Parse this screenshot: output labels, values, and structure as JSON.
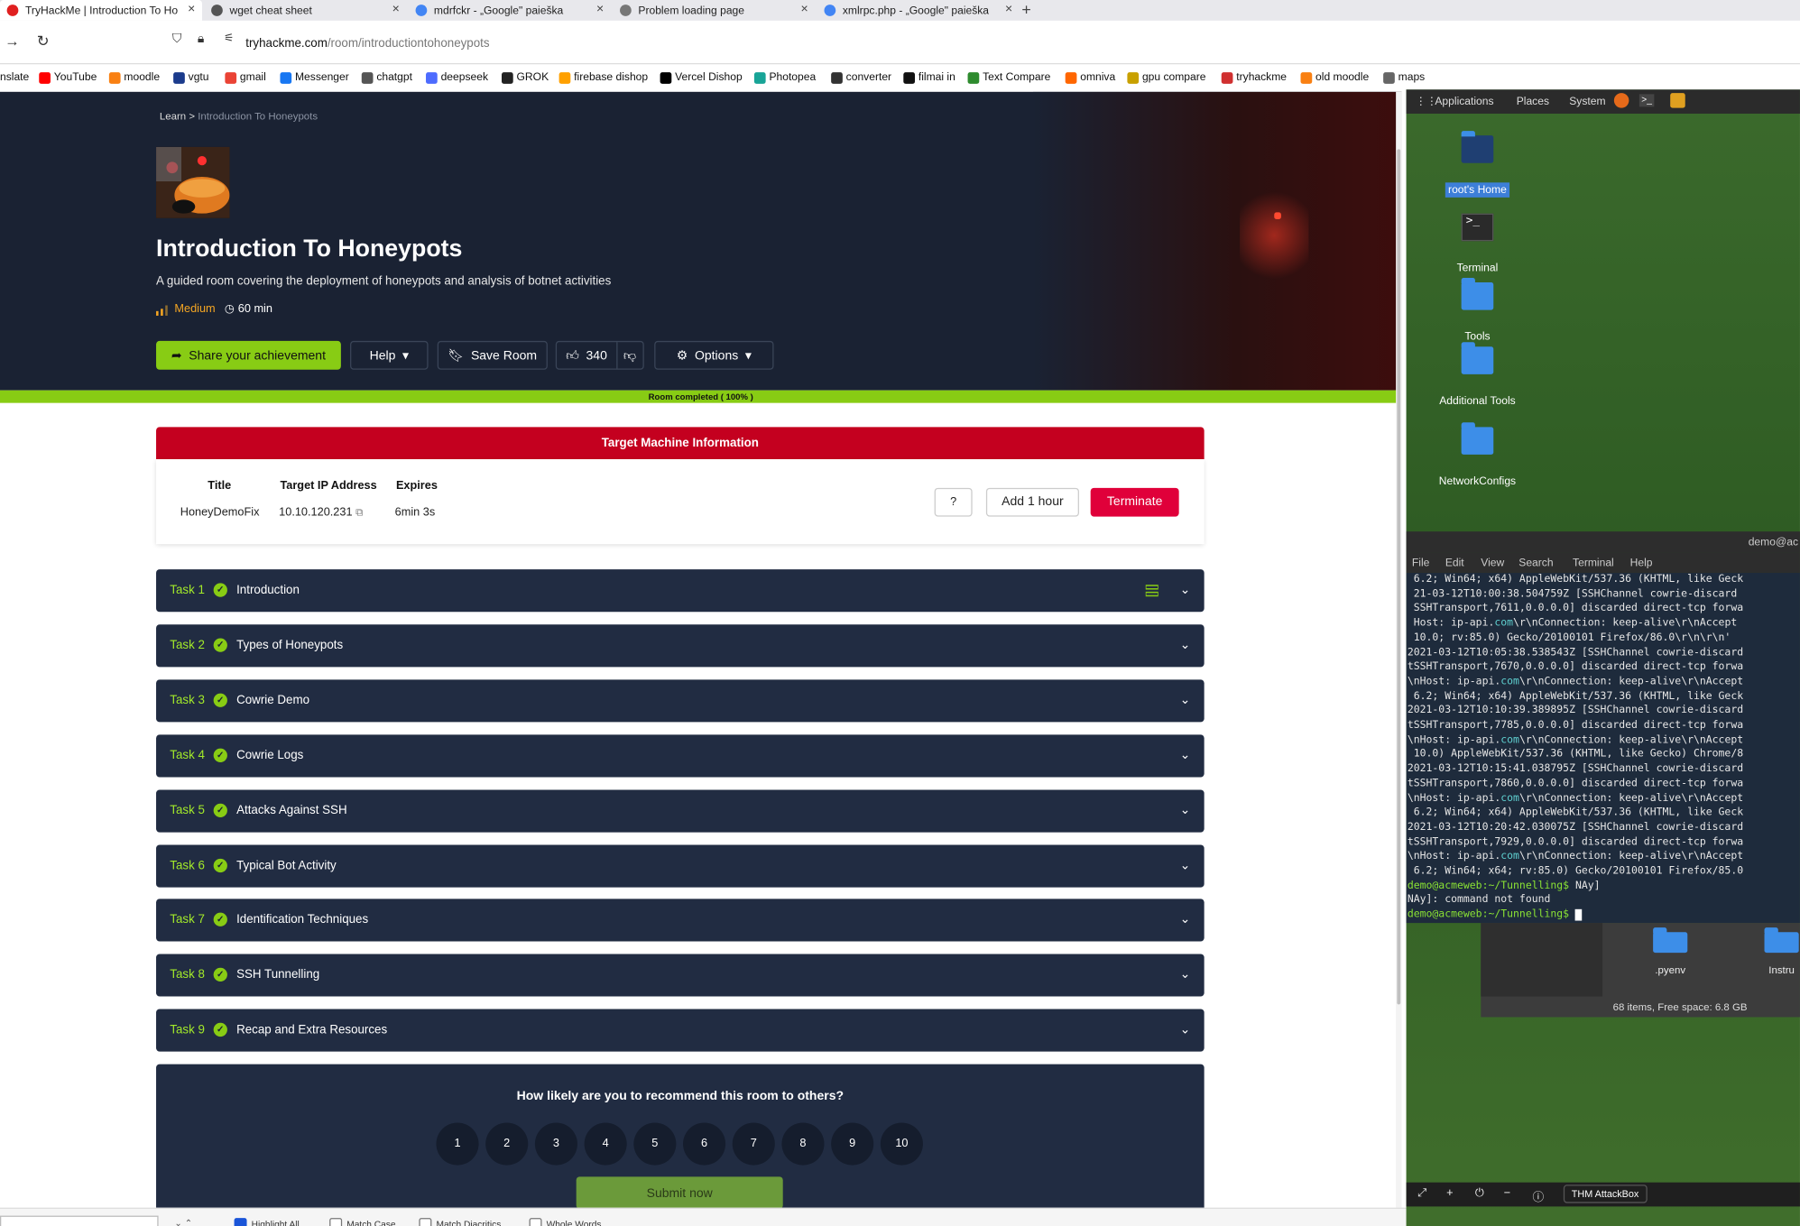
{
  "browser": {
    "tabs": [
      {
        "label": "TryHackMe | Introduction To Ho",
        "color": "#e02020",
        "active": true
      },
      {
        "label": "wget cheat sheet",
        "color": "#555555",
        "active": false
      },
      {
        "label": "mdrfckr - „Google\" paieška",
        "color": "#4285f4",
        "active": false
      },
      {
        "label": "Problem loading page",
        "color": "#777777",
        "active": false
      },
      {
        "label": "xmlrpc.php - „Google\" paieška",
        "color": "#4285f4",
        "active": false
      }
    ],
    "url_host": "tryhackme.com",
    "url_path": "/room/introductiontohoneypots",
    "bookmarks": [
      {
        "label": "nslate",
        "color": "transparent"
      },
      {
        "label": "YouTube",
        "color": "#ff0000"
      },
      {
        "label": "moodle",
        "color": "#f98012"
      },
      {
        "label": "vgtu",
        "color": "#1b3b8c"
      },
      {
        "label": "gmail",
        "color": "#ea4335"
      },
      {
        "label": "Messenger",
        "color": "#1877f2"
      },
      {
        "label": "chatgpt",
        "color": "#555555"
      },
      {
        "label": "deepseek",
        "color": "#4d6bfe"
      },
      {
        "label": "GROK",
        "color": "#222222"
      },
      {
        "label": "firebase dishop",
        "color": "#ffa000"
      },
      {
        "label": "Vercel Dishop",
        "color": "#000000"
      },
      {
        "label": "Photopea",
        "color": "#18a497"
      },
      {
        "label": "converter",
        "color": "#333333"
      },
      {
        "label": "filmai in",
        "color": "#111111"
      },
      {
        "label": "Text Compare",
        "color": "#2e8b2e"
      },
      {
        "label": "omniva",
        "color": "#ff6600"
      },
      {
        "label": "gpu compare",
        "color": "#c8a000"
      },
      {
        "label": "tryhackme",
        "color": "#d03030"
      },
      {
        "label": "old moodle",
        "color": "#f98012"
      },
      {
        "label": "maps",
        "color": "#666666"
      }
    ]
  },
  "room": {
    "breadcrumb_root": "Learn",
    "breadcrumb_sep": ">",
    "breadcrumb_current": "Introduction To Honeypots",
    "title": "Introduction To Honeypots",
    "description": "A guided room covering the deployment of honeypots and analysis of botnet activities",
    "difficulty": "Medium",
    "duration": "60 min",
    "buttons": {
      "share": "Share your achievement",
      "help": "Help",
      "save": "Save Room",
      "likes": "340",
      "options": "Options"
    },
    "progress_label": "Room completed ( 100% )",
    "progress": 100
  },
  "target_machine": {
    "header": "Target Machine Information",
    "col_title": "Title",
    "col_ip": "Target IP Address",
    "col_expires": "Expires",
    "title": "HoneyDemoFix",
    "ip": "10.10.120.231",
    "expires": "6min 3s",
    "help_label": "?",
    "add_hour_label": "Add 1 hour",
    "terminate_label": "Terminate"
  },
  "tasks": [
    {
      "num": "Task 1",
      "name": "Introduction"
    },
    {
      "num": "Task 2",
      "name": "Types of Honeypots"
    },
    {
      "num": "Task 3",
      "name": "Cowrie Demo"
    },
    {
      "num": "Task 4",
      "name": "Cowrie Logs"
    },
    {
      "num": "Task 5",
      "name": "Attacks Against SSH"
    },
    {
      "num": "Task 6",
      "name": "Typical Bot Activity"
    },
    {
      "num": "Task 7",
      "name": "Identification Techniques"
    },
    {
      "num": "Task 8",
      "name": "SSH Tunnelling"
    },
    {
      "num": "Task 9",
      "name": "Recap and Extra Resources"
    }
  ],
  "recommend": {
    "question": "How likely are you to recommend this room to others?",
    "ratings": [
      "1",
      "2",
      "3",
      "4",
      "5",
      "6",
      "7",
      "8",
      "9",
      "10"
    ],
    "submit": "Submit now"
  },
  "findbar": {
    "options": [
      {
        "label": "Highlight All",
        "checked": true
      },
      {
        "label": "Match Case",
        "checked": false
      },
      {
        "label": "Match Diacritics",
        "checked": false
      },
      {
        "label": "Whole Words",
        "checked": false
      }
    ]
  },
  "attackbox": {
    "panel": {
      "applications": "Applications",
      "places": "Places",
      "system": "System"
    },
    "desktop_icons": [
      {
        "label": "root's Home",
        "kind": "home",
        "selected": true
      },
      {
        "label": "Terminal",
        "kind": "terminal",
        "selected": false
      },
      {
        "label": "Tools",
        "kind": "folder",
        "selected": false
      },
      {
        "label": "Additional Tools",
        "kind": "folder",
        "selected": false
      },
      {
        "label": "NetworkConfigs",
        "kind": "folder",
        "selected": false
      }
    ],
    "terminal_title": "demo@ac",
    "terminal_menu": [
      "File",
      "Edit",
      "View",
      "Search",
      "Terminal",
      "Help"
    ],
    "terminal_lines": [
      " 6.2; Win64; x64) AppleWebKit/537.36 (KHTML, like Geck",
      " 21-03-12T10:00:38.504759Z [SSHChannel cowrie-discard",
      " SSHTransport,7611,0.0.0.0] discarded direct-tcp forwa",
      " Host: ip-api.com\\r\\nConnection: keep-alive\\r\\nAccept",
      " 10.0; rv:85.0) Gecko/20100101 Firefox/86.0\\r\\n\\r\\n'",
      "2021-03-12T10:05:38.538543Z [SSHChannel cowrie-discard",
      "tSSHTransport,7670,0.0.0.0] discarded direct-tcp forwa",
      "\\nHost: ip-api.com\\r\\nConnection: keep-alive\\r\\nAccept",
      " 6.2; Win64; x64) AppleWebKit/537.36 (KHTML, like Geck",
      "2021-03-12T10:10:39.389895Z [SSHChannel cowrie-discard",
      "tSSHTransport,7785,0.0.0.0] discarded direct-tcp forwa",
      "\\nHost: ip-api.com\\r\\nConnection: keep-alive\\r\\nAccept",
      " 10.0) AppleWebKit/537.36 (KHTML, like Gecko) Chrome/8",
      "2021-03-12T10:15:41.038795Z [SSHChannel cowrie-discard",
      "tSSHTransport,7860,0.0.0.0] discarded direct-tcp forwa",
      "\\nHost: ip-api.com\\r\\nConnection: keep-alive\\r\\nAccept",
      " 6.2; Win64; x64) AppleWebKit/537.36 (KHTML, like Geck",
      "2021-03-12T10:20:42.030075Z [SSHChannel cowrie-discard",
      "tSSHTransport,7929,0.0.0.0] discarded direct-tcp forwa",
      "\\nHost: ip-api.com\\r\\nConnection: keep-alive\\r\\nAccept",
      " 6.2; Win64; x64; rv:85.0) Gecko/20100101 Firefox/85.0"
    ],
    "prompt1": "demo@acmeweb:~/Tunnelling$",
    "cmd1": " NAy]",
    "error_line": "NAy]: command not found",
    "prompt2": "demo@acmeweb:~/Tunnelling$",
    "fm_items": [
      ".pyenv",
      "Instru"
    ],
    "fm_status": "68 items, Free space: 6.8 GB",
    "label": "THM AttackBox"
  }
}
